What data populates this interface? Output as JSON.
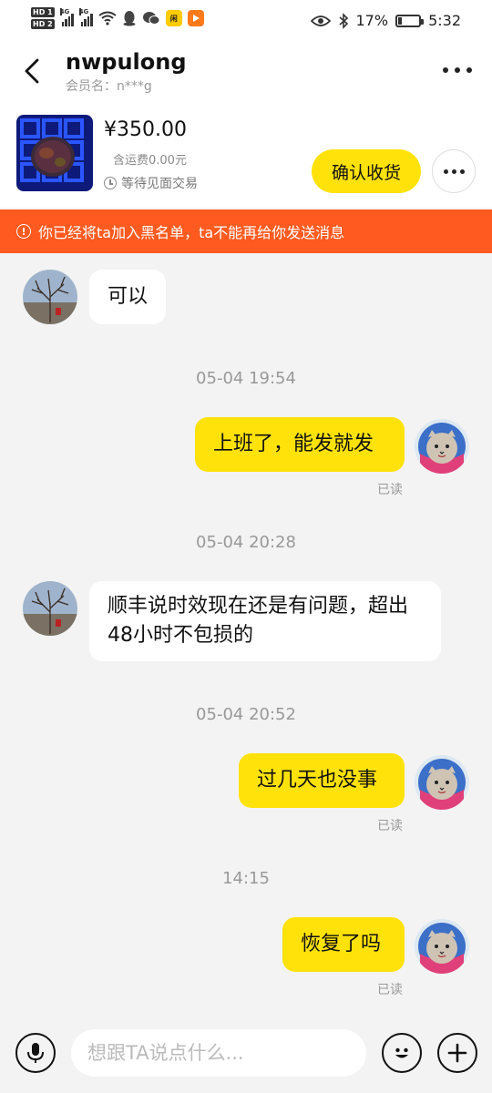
{
  "status_bar": {
    "hd1": "HD 1",
    "hd2": "HD 2",
    "net1": "4G",
    "net2": "4G",
    "battery_percent": "17%",
    "time": "5:32",
    "icons": [
      "wifi-icon",
      "qq-icon",
      "wechat-icon",
      "app-icon",
      "video-icon",
      "eye-icon",
      "bluetooth-icon",
      "battery-icon"
    ]
  },
  "header": {
    "title": "nwpulong",
    "subtitle": "会员名：n***g"
  },
  "product": {
    "price": "¥350.00",
    "shipping": "含运费0.00元",
    "status": "等待见面交易",
    "confirm_label": "确认收货"
  },
  "banner": {
    "text": "你已经将ta加入黑名单，ta不能再给你发送消息"
  },
  "messages": [
    {
      "side": "left",
      "text": "可以"
    },
    {
      "type": "timestamp",
      "text": "05-04 19:54"
    },
    {
      "side": "right",
      "text": "上班了，能发就发",
      "status": "已读"
    },
    {
      "type": "timestamp",
      "text": "05-04 20:28"
    },
    {
      "side": "left",
      "text": "顺丰说时效现在还是有问题，超出48小时不包损的"
    },
    {
      "type": "timestamp",
      "text": "05-04 20:52"
    },
    {
      "side": "right",
      "text": "过几天也没事",
      "status": "已读"
    },
    {
      "type": "timestamp",
      "text": "14:15"
    },
    {
      "side": "right",
      "text": "恢复了吗",
      "status": "已读"
    }
  ],
  "input": {
    "placeholder": "想跟TA说点什么..."
  },
  "colors": {
    "accent_yellow": "#ffe20a",
    "banner_orange": "#ff5a1f",
    "background": "#f3f3f3"
  }
}
